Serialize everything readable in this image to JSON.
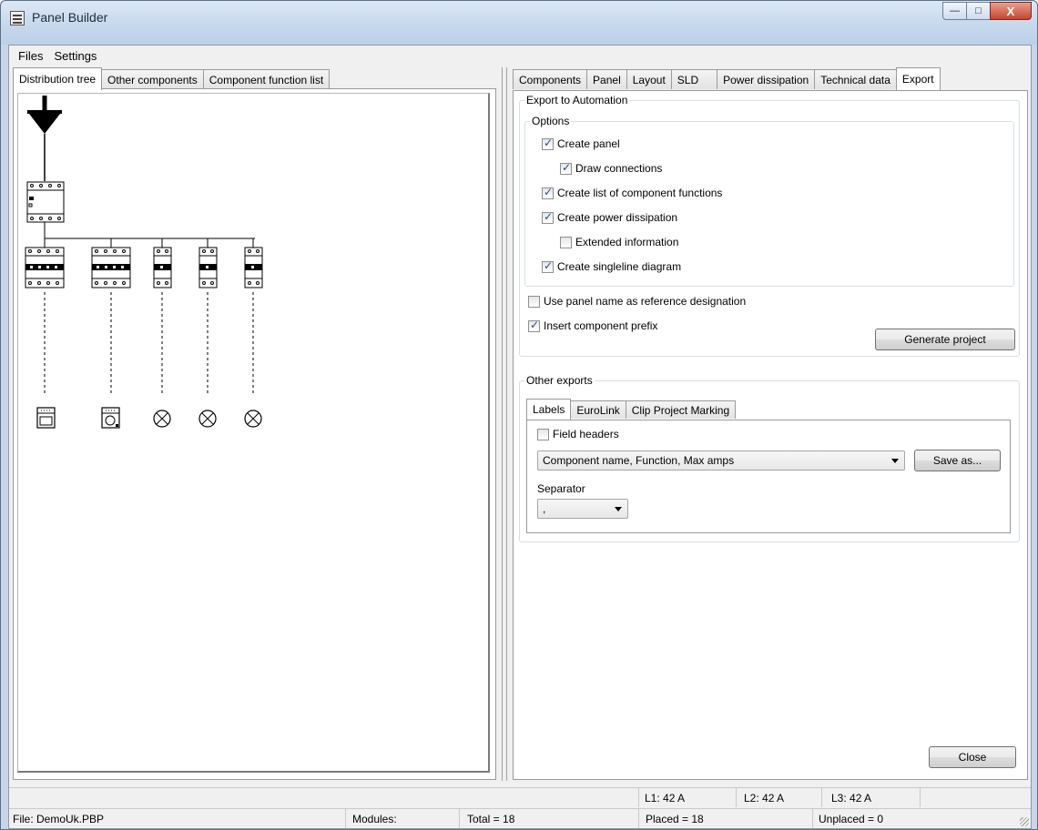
{
  "window": {
    "title": "Panel Builder",
    "buttons": {
      "minimize": "—",
      "maximize": "□",
      "close": "X"
    }
  },
  "menu": {
    "items": [
      "Files",
      "Settings"
    ]
  },
  "left_tabs": [
    "Distribution tree",
    "Other components",
    "Component function list"
  ],
  "right_tabs": [
    "Components",
    "Panel",
    "Layout",
    "SLD",
    "Power dissipation",
    "Technical data",
    "Export"
  ],
  "export": {
    "group_title": "Export to Automation",
    "options": {
      "title": "Options",
      "items": [
        {
          "label": "Create panel",
          "checked": true
        },
        {
          "label": "Draw connections",
          "checked": true
        },
        {
          "label": "Create list of component functions",
          "checked": true
        },
        {
          "label": "Create power dissipation",
          "checked": true
        },
        {
          "label": "Extended information",
          "checked": false
        },
        {
          "label": "Create singleline diagram",
          "checked": true
        }
      ]
    },
    "use_panel_name": {
      "label": "Use panel name as reference designation",
      "checked": false
    },
    "insert_prefix": {
      "label": "Insert component prefix",
      "checked": true
    },
    "generate_button": "Generate project"
  },
  "other_exports": {
    "title": "Other exports",
    "tabs": [
      "Labels",
      "EuroLink",
      "Clip Project Marking"
    ],
    "field_headers": {
      "label": "Field headers",
      "checked": false
    },
    "format_value": "Component name, Function, Max amps",
    "save_as_button": "Save as...",
    "separator_label": "Separator",
    "separator_value": ","
  },
  "close_button": "Close",
  "status": {
    "l1": "L1: 42 A",
    "l2": "L2: 42 A",
    "l3": "L3: 42 A",
    "file": "File: DemoUk.PBP",
    "modules": "Modules:",
    "total": "Total = 18",
    "placed": "Placed = 18",
    "unplaced": "Unplaced = 0"
  },
  "tree_icons": [
    "supply-icon",
    "main-breaker-icon",
    "rcd-icon",
    "rcd-icon",
    "mcb-icon",
    "mcb-icon",
    "mcb-icon",
    "oven-icon",
    "washing-machine-icon",
    "lamp-icon",
    "lamp-icon",
    "lamp-icon"
  ]
}
